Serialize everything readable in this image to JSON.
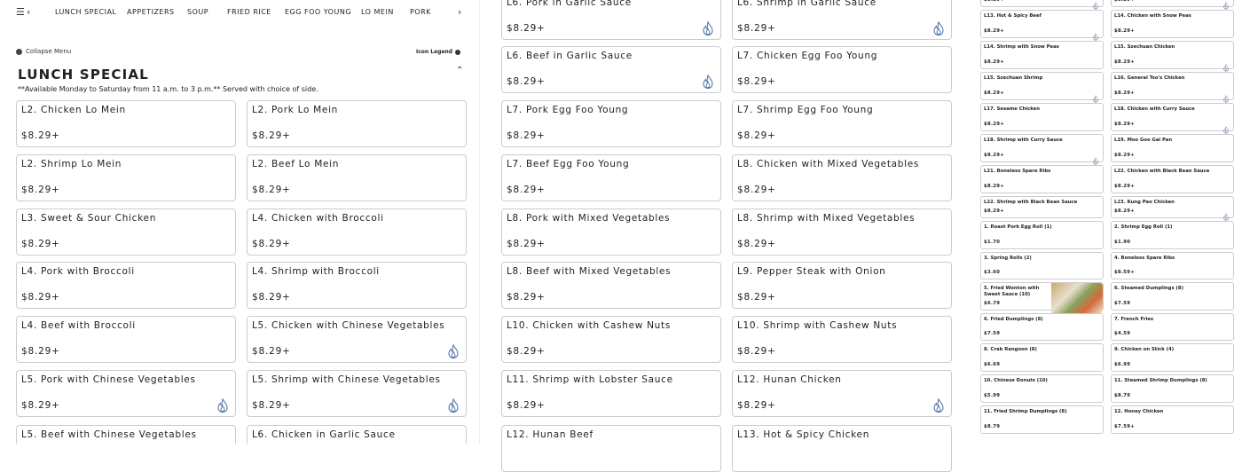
{
  "nav": {
    "items": [
      "LUNCH SPECIAL",
      "APPETIZERS",
      "SOUP",
      "FRIED RICE",
      "EGG FOO YOUNG",
      "LO MEIN",
      "PORK"
    ]
  },
  "menu": {
    "collapse_label": "Collapse Menu",
    "legend_label": "Icon Legend"
  },
  "section": {
    "title": "LUNCH SPECIAL",
    "availability": "**Available Monday to Saturday from 11 a.m. to 3 p.m.** Served with choice of side."
  },
  "left_items": [
    {
      "name": "L2. Chicken Lo Mein",
      "price": "$8.29+",
      "spicy": false
    },
    {
      "name": "L2. Pork Lo Mein",
      "price": "$8.29+",
      "spicy": false
    },
    {
      "name": "L2. Shrimp Lo Mein",
      "price": "$8.29+",
      "spicy": false
    },
    {
      "name": "L2. Beef Lo Mein",
      "price": "$8.29+",
      "spicy": false
    },
    {
      "name": "L3. Sweet & Sour Chicken",
      "price": "$8.29+",
      "spicy": false
    },
    {
      "name": "L4. Chicken with Broccoli",
      "price": "$8.29+",
      "spicy": false
    },
    {
      "name": "L4. Pork with Broccoli",
      "price": "$8.29+",
      "spicy": false
    },
    {
      "name": "L4. Shrimp with Broccoli",
      "price": "$8.29+",
      "spicy": false
    },
    {
      "name": "L4. Beef with Broccoli",
      "price": "$8.29+",
      "spicy": false
    },
    {
      "name": "L5. Chicken with Chinese Vegetables",
      "price": "$8.29+",
      "spicy": true
    },
    {
      "name": "L5. Pork with Chinese Vegetables",
      "price": "$8.29+",
      "spicy": true
    },
    {
      "name": "L5. Shrimp with Chinese Vegetables",
      "price": "$8.29+",
      "spicy": true
    },
    {
      "name": "L5. Beef with Chinese Vegetables",
      "price": "",
      "spicy": false
    },
    {
      "name": "L6. Chicken in Garlic Sauce",
      "price": "",
      "spicy": false
    }
  ],
  "mid_items": [
    {
      "name": "L6. Pork in Garlic Sauce",
      "price": "$8.29+",
      "spicy": true
    },
    {
      "name": "L6. Shrimp in Garlic Sauce",
      "price": "$8.29+",
      "spicy": true
    },
    {
      "name": "L6. Beef in Garlic Sauce",
      "price": "$8.29+",
      "spicy": true
    },
    {
      "name": "L7. Chicken Egg Foo Young",
      "price": "$8.29+",
      "spicy": false
    },
    {
      "name": "L7. Pork Egg Foo Young",
      "price": "$8.29+",
      "spicy": false
    },
    {
      "name": "L7. Shrimp Egg Foo Young",
      "price": "$8.29+",
      "spicy": false
    },
    {
      "name": "L7. Beef Egg Foo Young",
      "price": "$8.29+",
      "spicy": false
    },
    {
      "name": "L8. Chicken with Mixed Vegetables",
      "price": "$8.29+",
      "spicy": false
    },
    {
      "name": "L8. Pork with Mixed Vegetables",
      "price": "$8.29+",
      "spicy": false
    },
    {
      "name": "L8. Shrimp with Mixed Vegetables",
      "price": "$8.29+",
      "spicy": false
    },
    {
      "name": "L8. Beef with Mixed Vegetables",
      "price": "$8.29+",
      "spicy": false
    },
    {
      "name": "L9. Pepper Steak with Onion",
      "price": "$8.29+",
      "spicy": false
    },
    {
      "name": "L10. Chicken with Cashew Nuts",
      "price": "$8.29+",
      "spicy": false
    },
    {
      "name": "L10. Shrimp with Cashew Nuts",
      "price": "$8.29+",
      "spicy": false
    },
    {
      "name": "L11. Shrimp with Lobster Sauce",
      "price": "$8.29+",
      "spicy": false
    },
    {
      "name": "L12. Hunan Chicken",
      "price": "$8.29+",
      "spicy": true
    },
    {
      "name": "L12. Hunan Beef",
      "price": "",
      "spicy": false
    },
    {
      "name": "L13. Hot & Spicy Chicken",
      "price": "",
      "spicy": false
    }
  ],
  "right_items": [
    {
      "name": "",
      "price": "$8.29+",
      "spicy": true
    },
    {
      "name": "",
      "price": "$8.29+",
      "spicy": true
    },
    {
      "name": "L13. Hot & Spicy Beef",
      "price": "$8.29+",
      "spicy": true
    },
    {
      "name": "L14. Chicken with Snow Peas",
      "price": "$8.29+",
      "spicy": false
    },
    {
      "name": "L14. Shrimp with Snow Peas",
      "price": "$8.29+",
      "spicy": false
    },
    {
      "name": "L15. Szechuan Chicken",
      "price": "$8.29+",
      "spicy": true
    },
    {
      "name": "L15. Szechuan Shrimp",
      "price": "$8.29+",
      "spicy": true
    },
    {
      "name": "L16. General Tso's Chicken",
      "price": "$8.29+",
      "spicy": true
    },
    {
      "name": "L17. Sesame Chicken",
      "price": "$8.29+",
      "spicy": false
    },
    {
      "name": "L18. Chicken with Curry Sauce",
      "price": "$8.29+",
      "spicy": true
    },
    {
      "name": "L18. Shrimp with Curry Sauce",
      "price": "$8.29+",
      "spicy": true
    },
    {
      "name": "L19. Moo Goo Gai Pan",
      "price": "$8.29+",
      "spicy": false
    },
    {
      "name": "L21. Boneless Spare Ribs",
      "price": "$8.29+",
      "spicy": false
    },
    {
      "name": "L22. Chicken with Black Bean Sauce",
      "price": "$8.29+",
      "spicy": false
    },
    {
      "name": "L22. Shrimp with Black Bean Sauce",
      "price": "$8.29+",
      "spicy": false
    },
    {
      "name": "L23. Kung Pao Chicken",
      "price": "$8.29+",
      "spicy": true
    },
    {
      "name": "1. Roast Pork Egg Roll (1)",
      "price": "$1.70",
      "spicy": false
    },
    {
      "name": "2. Shrimp Egg Roll (1)",
      "price": "$1.90",
      "spicy": false
    },
    {
      "name": "3. Spring Rolls (2)",
      "price": "$3.60",
      "spicy": false
    },
    {
      "name": "4. Boneless Spare Ribs",
      "price": "$8.59+",
      "spicy": false
    },
    {
      "name": "5. Fried Wonton with Sweet Sauce (10)",
      "price": "$6.79",
      "spicy": false,
      "image": true
    },
    {
      "name": "6. Steamed Dumplings (8)",
      "price": "$7.59",
      "spicy": false
    },
    {
      "name": "6. Fried Dumplings (8)",
      "price": "$7.59",
      "spicy": false
    },
    {
      "name": "7. French Fries",
      "price": "$4.59",
      "spicy": false
    },
    {
      "name": "8. Crab Rangoon (8)",
      "price": "$6.69",
      "spicy": false
    },
    {
      "name": "9. Chicken on Stick (4)",
      "price": "$6.99",
      "spicy": false
    },
    {
      "name": "10. Chinese Donuts (10)",
      "price": "$5.99",
      "spicy": false
    },
    {
      "name": "11. Steamed Shrimp Dumplings (8)",
      "price": "$8.79",
      "spicy": false
    },
    {
      "name": "11. Fried Shrimp Dumplings (8)",
      "price": "$8.79",
      "spicy": false
    },
    {
      "name": "12. Honey Chicken",
      "price": "$7.59+",
      "spicy": false
    }
  ],
  "colors": {
    "border": "#cccccc",
    "text": "#222222",
    "flame": "#4a6fa5"
  }
}
